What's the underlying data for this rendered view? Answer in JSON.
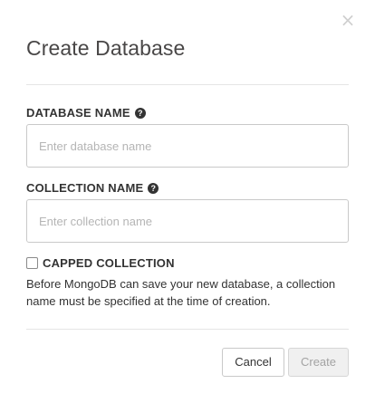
{
  "dialog": {
    "title": "Create Database",
    "close_symbol": "×"
  },
  "database_name": {
    "label": "DATABASE NAME",
    "help_icon": "question-circle-icon",
    "help_symbol": "?",
    "value": "",
    "placeholder": "Enter database name"
  },
  "collection_name": {
    "label": "COLLECTION NAME",
    "help_icon": "question-circle-icon",
    "help_symbol": "?",
    "value": "",
    "placeholder": "Enter collection name"
  },
  "capped_collection": {
    "label": "CAPPED COLLECTION",
    "checked": false
  },
  "note": "Before MongoDB can save your new database, a collection name must be specified at the time of creation.",
  "buttons": {
    "cancel_label": "Cancel",
    "create_label": "Create"
  }
}
